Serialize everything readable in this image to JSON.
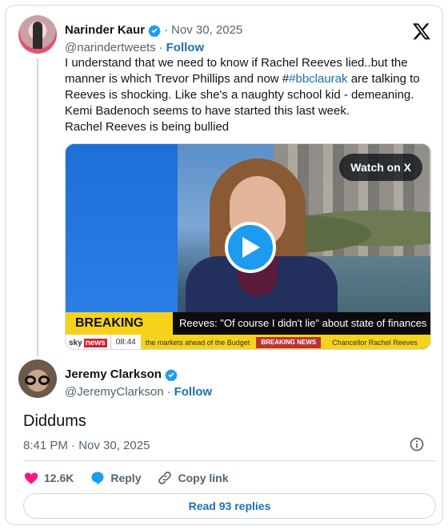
{
  "quoted_tweet": {
    "author_name": "Narinder Kaur",
    "separator": "·",
    "date": "Nov 30, 2025",
    "handle": "@narindertweets",
    "handle_separator": "·",
    "follow_label": "Follow",
    "text_before_link": "I understand that we need to know if Rachel Reeves lied..but the manner is which Trevor Phillips and now #",
    "link_text": "#bbclaurak",
    "text_after_link": " are talking to Reeves is shocking. Like she's a naughty school kid - demeaning.\nKemi Badenoch seems to have started this last week.\nRachel Reeves is being bullied",
    "media": {
      "watch_label": "Watch on X",
      "breaking_label": "BREAKING NEWS",
      "headline": "Reeves: \"Of course I didn't lie\" about state of finances",
      "channel_sky": "sky",
      "channel_news": "news",
      "clock": "08:44",
      "ticker_text": "the markets ahead of the Budget",
      "ticker_box": "BREAKING NEWS",
      "ticker_text2": "Chancellor Rachel Reeves"
    }
  },
  "reply": {
    "author_name": "Jeremy Clarkson",
    "handle": "@JeremyClarkson",
    "handle_separator": "·",
    "follow_label": "Follow",
    "text": "Diddums",
    "timestamp": "8:41 PM · Nov 30, 2025"
  },
  "actions": {
    "likes": "12.6K",
    "reply_label": "Reply",
    "copy_label": "Copy link"
  },
  "read_replies_label": "Read 93 replies",
  "colors": {
    "accent_blue": "#1d9bf0",
    "link_blue": "#1d6fb8",
    "like_pink": "#f91880",
    "muted": "#536471"
  }
}
